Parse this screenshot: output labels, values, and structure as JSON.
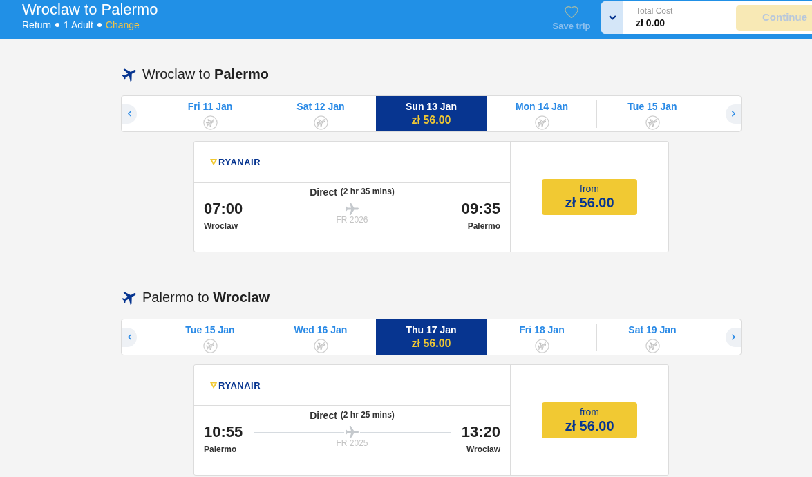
{
  "header": {
    "title": "Wroclaw to Palermo",
    "trip_type": "Return",
    "passengers": "1 Adult",
    "change_link": "Change",
    "save_trip": {
      "label": "Save trip",
      "disabled": true
    },
    "total_cost": {
      "label": "Total Cost",
      "value": "zł 0.00"
    },
    "continue_button": {
      "label": "Continue",
      "disabled": true
    }
  },
  "legs": [
    {
      "title": "Wroclaw to **Palermo**",
      "dates": [
        {
          "label": "Fri 11 Jan",
          "selected": false
        },
        {
          "label": "Sat 12 Jan",
          "selected": false
        },
        {
          "label": "Sun 13 Jan",
          "price": "zł 56.00",
          "selected": true
        },
        {
          "label": "Mon 14 Jan",
          "selected": false
        },
        {
          "label": "Tue 15 Jan",
          "selected": false
        }
      ],
      "flight": {
        "airline": "RYANAIR",
        "stops": "Direct",
        "duration": "(2 hr 35 mins)",
        "depart_time": "07:00",
        "depart_city": "Wroclaw",
        "flight_number": "FR 2026",
        "arrive_time": "09:35",
        "arrive_city": "Palermo",
        "price_label": "from",
        "price": "zł 56.00"
      }
    },
    {
      "title": "Palermo to **Wroclaw**",
      "dates": [
        {
          "label": "Tue 15 Jan",
          "selected": false
        },
        {
          "label": "Wed 16 Jan",
          "selected": false
        },
        {
          "label": "Thu 17 Jan",
          "price": "zł 56.00",
          "selected": true
        },
        {
          "label": "Fri 18 Jan",
          "selected": false
        },
        {
          "label": "Sat 19 Jan",
          "selected": false
        }
      ],
      "flight": {
        "airline": "RYANAIR",
        "stops": "Direct",
        "duration": "(2 hr 25 mins)",
        "depart_time": "10:55",
        "depart_city": "Palermo",
        "flight_number": "FR 2025",
        "arrive_time": "13:20",
        "arrive_city": "Wroclaw",
        "price_label": "from",
        "price": "zł 56.00"
      }
    }
  ]
}
